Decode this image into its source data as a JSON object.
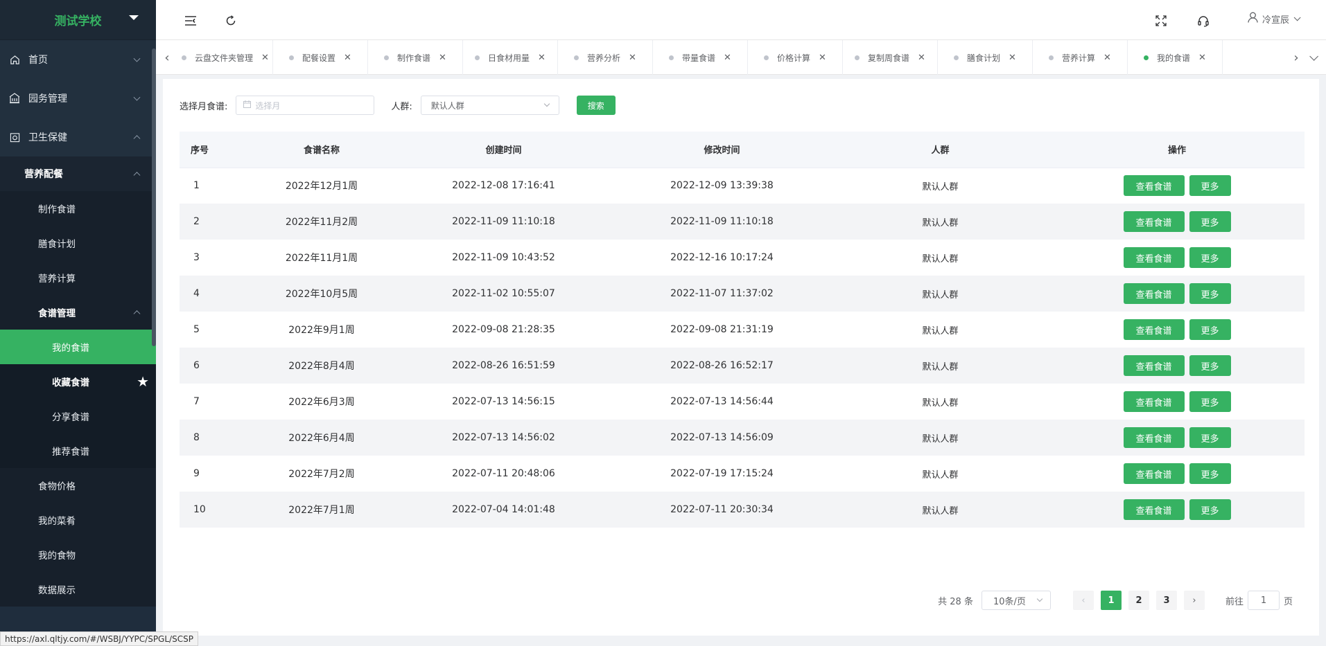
{
  "sidebar": {
    "logo": "测试学校",
    "top_items": [
      {
        "label": "首页",
        "icon": "home-icon",
        "expanded": false
      },
      {
        "label": "园务管理",
        "icon": "building-icon",
        "expanded": false
      },
      {
        "label": "卫生保健",
        "icon": "health-icon",
        "expanded": true
      }
    ],
    "group_label": "营养配餐",
    "group_items": [
      "制作食谱",
      "膳食计划",
      "营养计算"
    ],
    "subgroup_label": "食谱管理",
    "subgroup_items": [
      {
        "label": "我的食谱",
        "active": true
      },
      {
        "label": "收藏食谱",
        "starred": true
      },
      {
        "label": "分享食谱"
      },
      {
        "label": "推荐食谱"
      }
    ],
    "tail_items": [
      "食物价格",
      "我的菜肴",
      "我的食物",
      "数据展示"
    ]
  },
  "header": {
    "icons": [
      "menu-collapse-icon",
      "refresh-icon",
      "fullscreen-icon",
      "headset-icon"
    ],
    "user_name": "冷宣辰"
  },
  "tabs": [
    {
      "label": "云盘文件夹管理",
      "active": false
    },
    {
      "label": "配餐设置",
      "active": false
    },
    {
      "label": "制作食谱",
      "active": false
    },
    {
      "label": "日食材用量",
      "active": false
    },
    {
      "label": "营养分析",
      "active": false
    },
    {
      "label": "带量食谱",
      "active": false
    },
    {
      "label": "价格计算",
      "active": false
    },
    {
      "label": "复制周食谱",
      "active": false
    },
    {
      "label": "膳食计划",
      "active": false
    },
    {
      "label": "营养计算",
      "active": false
    },
    {
      "label": "我的食谱",
      "active": true
    }
  ],
  "filters": {
    "month_label": "选择月食谱:",
    "month_placeholder": "选择月",
    "crowd_label": "人群:",
    "crowd_value": "默认人群",
    "search_label": "搜索"
  },
  "table": {
    "columns": [
      "序号",
      "食谱名称",
      "创建时间",
      "修改时间",
      "人群",
      "操作"
    ],
    "view_label": "查看食谱",
    "more_label": "更多",
    "rows": [
      {
        "no": "1",
        "name": "2022年12月1周",
        "created": "2022-12-08 17:16:41",
        "modified": "2022-12-09 13:39:38",
        "crowd": "默认人群"
      },
      {
        "no": "2",
        "name": "2022年11月2周",
        "created": "2022-11-09 11:10:18",
        "modified": "2022-11-09 11:10:18",
        "crowd": "默认人群"
      },
      {
        "no": "3",
        "name": "2022年11月1周",
        "created": "2022-11-09 10:43:52",
        "modified": "2022-12-16 10:17:24",
        "crowd": "默认人群"
      },
      {
        "no": "4",
        "name": "2022年10月5周",
        "created": "2022-11-02 10:55:07",
        "modified": "2022-11-07 11:37:02",
        "crowd": "默认人群"
      },
      {
        "no": "5",
        "name": "2022年9月1周",
        "created": "2022-09-08 21:28:35",
        "modified": "2022-09-08 21:31:19",
        "crowd": "默认人群"
      },
      {
        "no": "6",
        "name": "2022年8月4周",
        "created": "2022-08-26 16:51:59",
        "modified": "2022-08-26 16:52:17",
        "crowd": "默认人群"
      },
      {
        "no": "7",
        "name": "2022年6月3周",
        "created": "2022-07-13 14:56:15",
        "modified": "2022-07-13 14:56:44",
        "crowd": "默认人群"
      },
      {
        "no": "8",
        "name": "2022年6月4周",
        "created": "2022-07-13 14:56:02",
        "modified": "2022-07-13 14:56:09",
        "crowd": "默认人群"
      },
      {
        "no": "9",
        "name": "2022年7月2周",
        "created": "2022-07-11 20:48:06",
        "modified": "2022-07-19 17:15:24",
        "crowd": "默认人群"
      },
      {
        "no": "10",
        "name": "2022年7月1周",
        "created": "2022-07-04 14:01:48",
        "modified": "2022-07-11 20:30:34",
        "crowd": "默认人群"
      }
    ]
  },
  "pagination": {
    "total": "共 28 条",
    "page_size": "10条/页",
    "pages": [
      "1",
      "2",
      "3"
    ],
    "current": "1",
    "goto_prefix": "前往",
    "goto_value": "1",
    "goto_suffix": "页"
  },
  "status_url": "https://axl.qltjy.com/#/WSBJ/YYPC/SPGL/SCSP",
  "colors": {
    "accent": "#36b262",
    "sidebar_bg": "#1f2d3d"
  }
}
